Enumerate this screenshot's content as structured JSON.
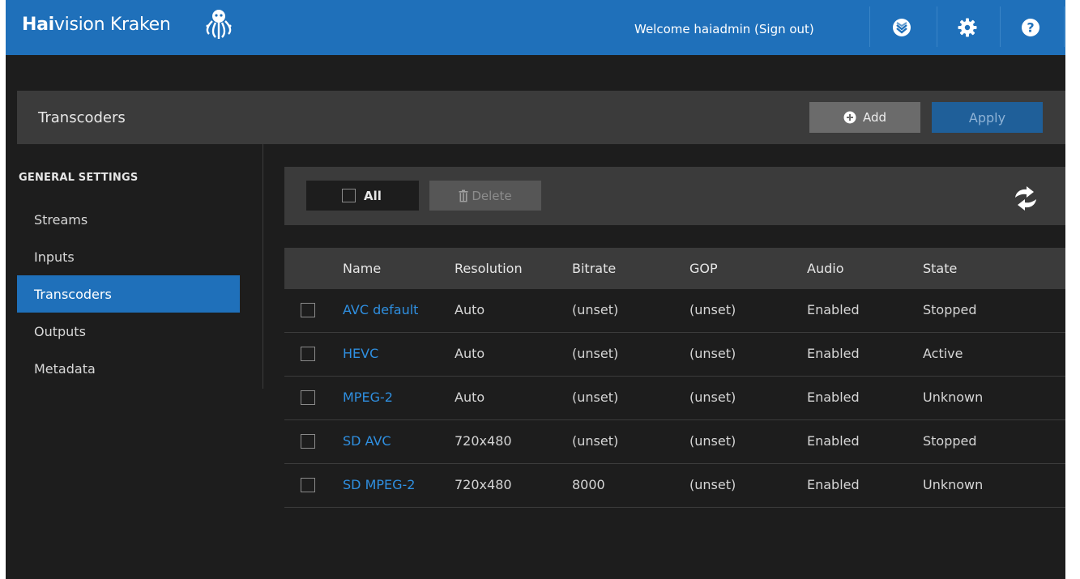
{
  "header": {
    "brand_bold": "Hai",
    "brand_rest": "vision Kraken",
    "welcome": "Welcome haiadmin",
    "sign_out": "(Sign out)",
    "icons": [
      "status-icon",
      "gear-icon",
      "help-icon"
    ]
  },
  "page": {
    "title": "Transcoders",
    "add_label": "Add",
    "apply_label": "Apply"
  },
  "sidebar": {
    "heading": "GENERAL SETTINGS",
    "items": [
      {
        "label": "Streams",
        "active": false
      },
      {
        "label": "Inputs",
        "active": false
      },
      {
        "label": "Transcoders",
        "active": true
      },
      {
        "label": "Outputs",
        "active": false
      },
      {
        "label": "Metadata",
        "active": false
      }
    ]
  },
  "toolbar": {
    "all_label": "All",
    "delete_label": "Delete"
  },
  "table": {
    "columns": [
      "Name",
      "Resolution",
      "Bitrate",
      "GOP",
      "Audio",
      "State"
    ],
    "rows": [
      [
        "AVC default",
        "Auto",
        "(unset)",
        "(unset)",
        "Enabled",
        "Stopped"
      ],
      [
        "HEVC",
        "Auto",
        "(unset)",
        "(unset)",
        "Enabled",
        "Active"
      ],
      [
        "MPEG-2",
        "Auto",
        "(unset)",
        "(unset)",
        "Enabled",
        "Unknown"
      ],
      [
        "SD AVC",
        "720x480",
        "(unset)",
        "(unset)",
        "Enabled",
        "Stopped"
      ],
      [
        "SD MPEG-2",
        "720x480",
        "8000",
        "(unset)",
        "Enabled",
        "Unknown"
      ]
    ]
  },
  "colors": {
    "accent": "#1f70ba",
    "link": "#2f8fe0",
    "panel": "#3b3b3b",
    "background": "#1d1d1d"
  }
}
